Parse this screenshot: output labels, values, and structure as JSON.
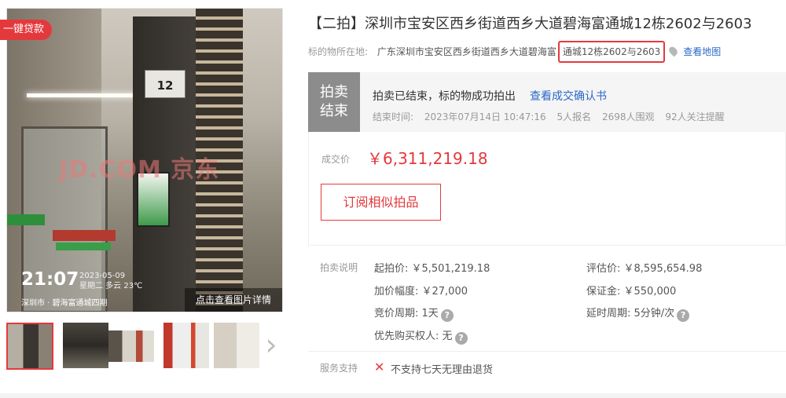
{
  "gallery": {
    "badge": "一键贷款",
    "watermark": "JD.COM 京东",
    "photo_sign": "12",
    "stamp_time": "21:07",
    "stamp_date": "2023-05-09",
    "stamp_weather": "星期二 多云 23℃",
    "stamp_location": "深圳市 · 碧海富通城四期",
    "view_details": "点击查看图片详情",
    "thumbnails": [
      "thumb-1",
      "thumb-2",
      "thumb-3",
      "thumb-4",
      "thumb-5"
    ],
    "next_icon": "chevron-right-icon"
  },
  "item": {
    "title": "【二拍】深圳市宝安区西乡街道西乡大道碧海富通城12栋2602与2603",
    "location_label": "标的物所在地:",
    "location_prefix": "广东深圳市宝安区西乡街道西乡大道碧海富",
    "location_highlight": "通城12栋2602与2603",
    "map_link": "查看地图"
  },
  "status": {
    "badge_line1": "拍卖",
    "badge_line2": "结束",
    "message": "拍卖已结束，标的物成功拍出",
    "confirm_link": "查看成交确认书",
    "end_time_label": "结束时间:",
    "end_time": "2023年07月14日 10:47:16",
    "signups": "5人报名",
    "views": "2698人围观",
    "reminders": "92人关注提醒"
  },
  "price": {
    "label": "成交价",
    "value": "￥6,311,219.18",
    "subscribe_button": "订阅相似拍品"
  },
  "details": {
    "section_label": "拍卖说明",
    "starting_price": "起拍价: ￥5,501,219.18",
    "appraisal": "评估价: ￥8,595,654.98",
    "increment": "加价幅度: ￥27,000",
    "deposit": "保证金: ￥550,000",
    "bidding_period": "竞价周期: 1天",
    "extension_period": "延时周期: 5分钟/次",
    "priority_buyer": "优先购买权人: 无"
  },
  "service": {
    "label": "服务支持",
    "no_return": "不支持七天无理由退货"
  },
  "colors": {
    "accent_red": "#e4393c",
    "link_blue": "#2a68c8",
    "badge_gray": "#8c8c8c"
  }
}
